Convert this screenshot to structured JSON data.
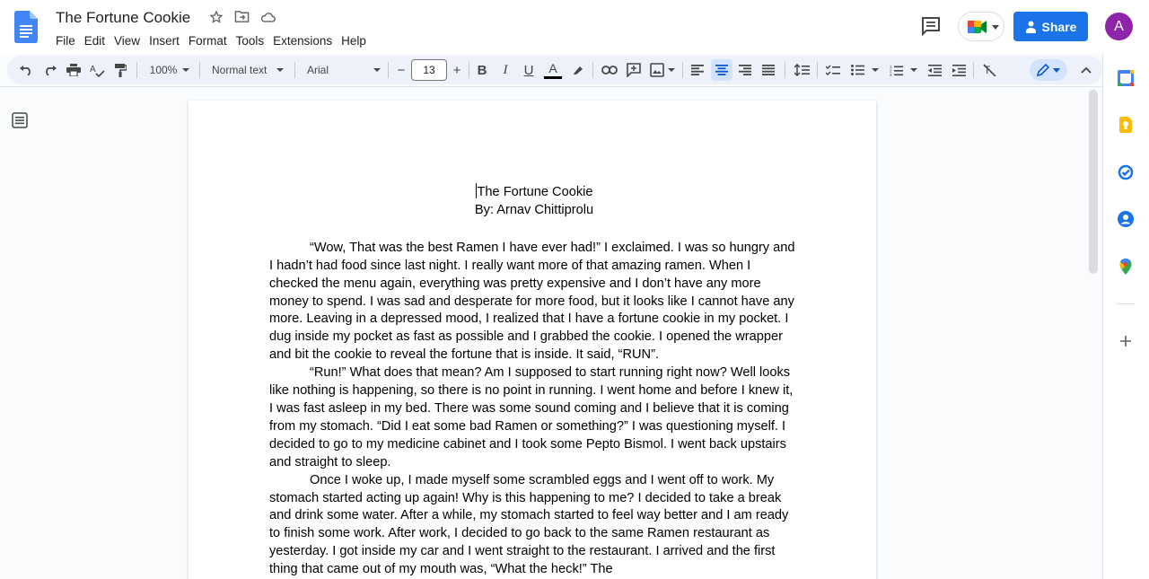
{
  "window": {
    "doc_title": "The Fortune Cookie",
    "menu": [
      "File",
      "Edit",
      "View",
      "Insert",
      "Format",
      "Tools",
      "Extensions",
      "Help"
    ]
  },
  "header": {
    "share_label": "Share",
    "avatar_letter": "A"
  },
  "toolbar": {
    "zoom": "100%",
    "style": "Normal text",
    "font": "Arial",
    "font_size": "13",
    "minus": "−",
    "plus": "+"
  },
  "document": {
    "heading_title": "The Fortune Cookie",
    "heading_author": "By: Arnav Chittiprolu",
    "paragraphs": [
      "“Wow, That was the best Ramen I have ever had!” I exclaimed. I was so hungry and I hadn’t had food since last night. I really want more of that amazing ramen. When I checked the menu again, everything was pretty expensive and I don’t have any more money to spend. I was sad and desperate for more food, but it looks like I cannot have any more. Leaving in a depressed mood, I realized that I have a fortune cookie in my pocket. I dug inside my pocket as fast as possible and I grabbed the cookie. I opened the wrapper and bit the cookie to reveal the fortune that is inside. It said, “RUN”.",
      "“Run!” What does that mean? Am I supposed to start running right now? Well looks like nothing is happening, so there is no point in running. I went home and before I knew it, I was fast asleep in my bed. There was some sound coming and I believe that it is coming from my stomach. “Did I eat some bad Ramen or something?” I was questioning myself. I decided to go to my medicine cabinet and I took some Pepto Bismol. I went back upstairs and straight to sleep.",
      "Once I woke up, I made myself some scrambled eggs and I went off to work. My stomach started acting up again! Why is this happening to me? I decided to take a break and drink some water. After a while, my stomach started to feel way better and I am ready to finish some work. After work, I decided to go back to the same Ramen restaurant as yesterday. I got inside my car and I went straight to the restaurant. I arrived and the first thing that came out of my mouth was, “What the heck!” The"
    ]
  },
  "colors": {
    "accent": "#1a73e8",
    "toolbar_bg": "#edf2fa",
    "avatar": "#8e24aa"
  }
}
